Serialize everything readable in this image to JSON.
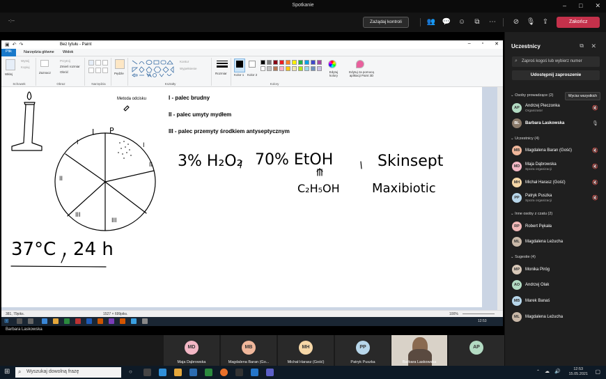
{
  "teams": {
    "window_title": "Spotkanie",
    "timer": "-:--",
    "control_button": "Zażądaj kontroli",
    "end_button": "Zakończ",
    "colors": {
      "end": "#c4314b",
      "panel_bg": "#1f1f1f"
    }
  },
  "paint": {
    "title": "Bez tytułu - Paint",
    "tabs": [
      "Plik",
      "Narzędzia główne",
      "Widok"
    ],
    "groups": {
      "clipboard": {
        "label": "Schowek",
        "paste": "Wklej",
        "cut": "Wytnij",
        "copy": "Kopiuj"
      },
      "image": {
        "label": "Obraz",
        "select": "Zaznacz",
        "crop": "Przytnij",
        "resize": "Zmień rozmiar",
        "rotate": "Obróć"
      },
      "tools": {
        "label": "Narzędzia"
      },
      "brushes": {
        "label": "Pędzle"
      },
      "shapes": {
        "label": "Kształty",
        "outline": "Kontur",
        "fill": "Wypełnienie"
      },
      "size": {
        "label": "Rozmiar"
      },
      "colors": {
        "label": "Kolory",
        "color1": "Kolor 1",
        "color2": "Kolor 2",
        "edit": "Edytuj kolory",
        "paint3d": "Edytuj za pomocą aplikacji Paint 3D"
      }
    },
    "palette": [
      "#000000",
      "#7f7f7f",
      "#880015",
      "#ed1c24",
      "#ff7f27",
      "#fff200",
      "#22b14c",
      "#00a2e8",
      "#3f48cc",
      "#a349a4",
      "#ffffff",
      "#c3c3c3",
      "#b97a57",
      "#ffaec9",
      "#ffc90e",
      "#efe4b0",
      "#b5e61d",
      "#99d9ea",
      "#7092be",
      "#c8bfe7"
    ],
    "canvas": {
      "label_method": "Metoda odcisku",
      "line1": "I - palec brudny",
      "line2": "II - palec umyty mydłem",
      "line3": "III - palec przemyty środkiem antyseptycznym",
      "temp": "37°C , 24 h",
      "h2o2": "3% H₂O₂",
      "etoh": "70% EtOH",
      "formula": "C₂H₅OH",
      "skinsept": "Skinsept",
      "maxibiotic": "Maxibiotic",
      "pie_labels": [
        "L",
        "P",
        "I",
        "I",
        "II",
        "II",
        "III",
        "III"
      ]
    },
    "status": {
      "pos": "381, 79piks.",
      "size": "1527 × 699piks.",
      "zoom": "100%"
    },
    "taskbar_time": "12:53"
  },
  "presenter": "Barbara Laskowska",
  "strip": [
    {
      "initials": "MD",
      "name": "Maja Dąbrowska",
      "color": "#f3b7c5"
    },
    {
      "initials": "MB",
      "name": "Magdalena Baran (Go...",
      "color": "#f0b79b"
    },
    {
      "initials": "MH",
      "name": "Michał Harasz (Gość)",
      "color": "#f6d7a7"
    },
    {
      "initials": "PP",
      "name": "Patryk Puszka",
      "color": "#b7d6ea"
    },
    {
      "initials": "",
      "name": "Barbara Laskowska",
      "color": "#8a7a6a"
    },
    {
      "initials": "AP",
      "name": "",
      "color": "#b3dbc3"
    }
  ],
  "panel": {
    "title": "Uczestnicy",
    "search_placeholder": "Zaproś kogoś lub wybierz numer",
    "invite": "Udostępnij zaproszenie",
    "sections": {
      "hosts": "Osoby prowadzące (2)",
      "admit_all": "Wycisz wszystkich",
      "attendees": "Uczestnicy (4)",
      "others": "Inne osoby z czatu (2)",
      "suggestions": "Sugestie (4)"
    },
    "hosts": [
      {
        "initials": "AP",
        "name": "Andrzej Pieczonka",
        "role": "Organizator",
        "color": "#b3dbc3"
      },
      {
        "initials": "BL",
        "name": "Barbara Laskowska",
        "role": "",
        "color": "#8a7a6a"
      }
    ],
    "attendees": [
      {
        "initials": "MB",
        "name": "Magdalena Baran (Gość)",
        "role": "",
        "color": "#f0b79b"
      },
      {
        "initials": "MD",
        "name": "Maja Dąbrowska",
        "role": "Spoza organizacji",
        "color": "#f3b7c5"
      },
      {
        "initials": "MH",
        "name": "Michał Harasz (Gość)",
        "role": "",
        "color": "#f6d7a7"
      },
      {
        "initials": "PP",
        "name": "Patryk Puszka",
        "role": "Spoza organizacji",
        "color": "#b7d6ea"
      }
    ],
    "others": [
      {
        "initials": "RP",
        "name": "Robert Pękała",
        "color": "#f0b7b7"
      },
      {
        "initials": "ML",
        "name": "Magdalena Leżucha",
        "color": "#c9b8a8"
      }
    ],
    "suggestions": [
      {
        "initials": "MP",
        "name": "Monika Piróg",
        "color": "#d8c8b8"
      },
      {
        "initials": "AO",
        "name": "Andrzej Olak",
        "color": "#b3dbc3"
      },
      {
        "initials": "MB",
        "name": "Marek Banaś",
        "color": "#b7d6ea"
      },
      {
        "initials": "ML",
        "name": "Magdalena Leżucha",
        "color": "#c9b8a8"
      }
    ]
  },
  "taskbar": {
    "search": "Wyszukaj dowolną frazę",
    "time": "12:53",
    "date": "15.05.2021"
  }
}
